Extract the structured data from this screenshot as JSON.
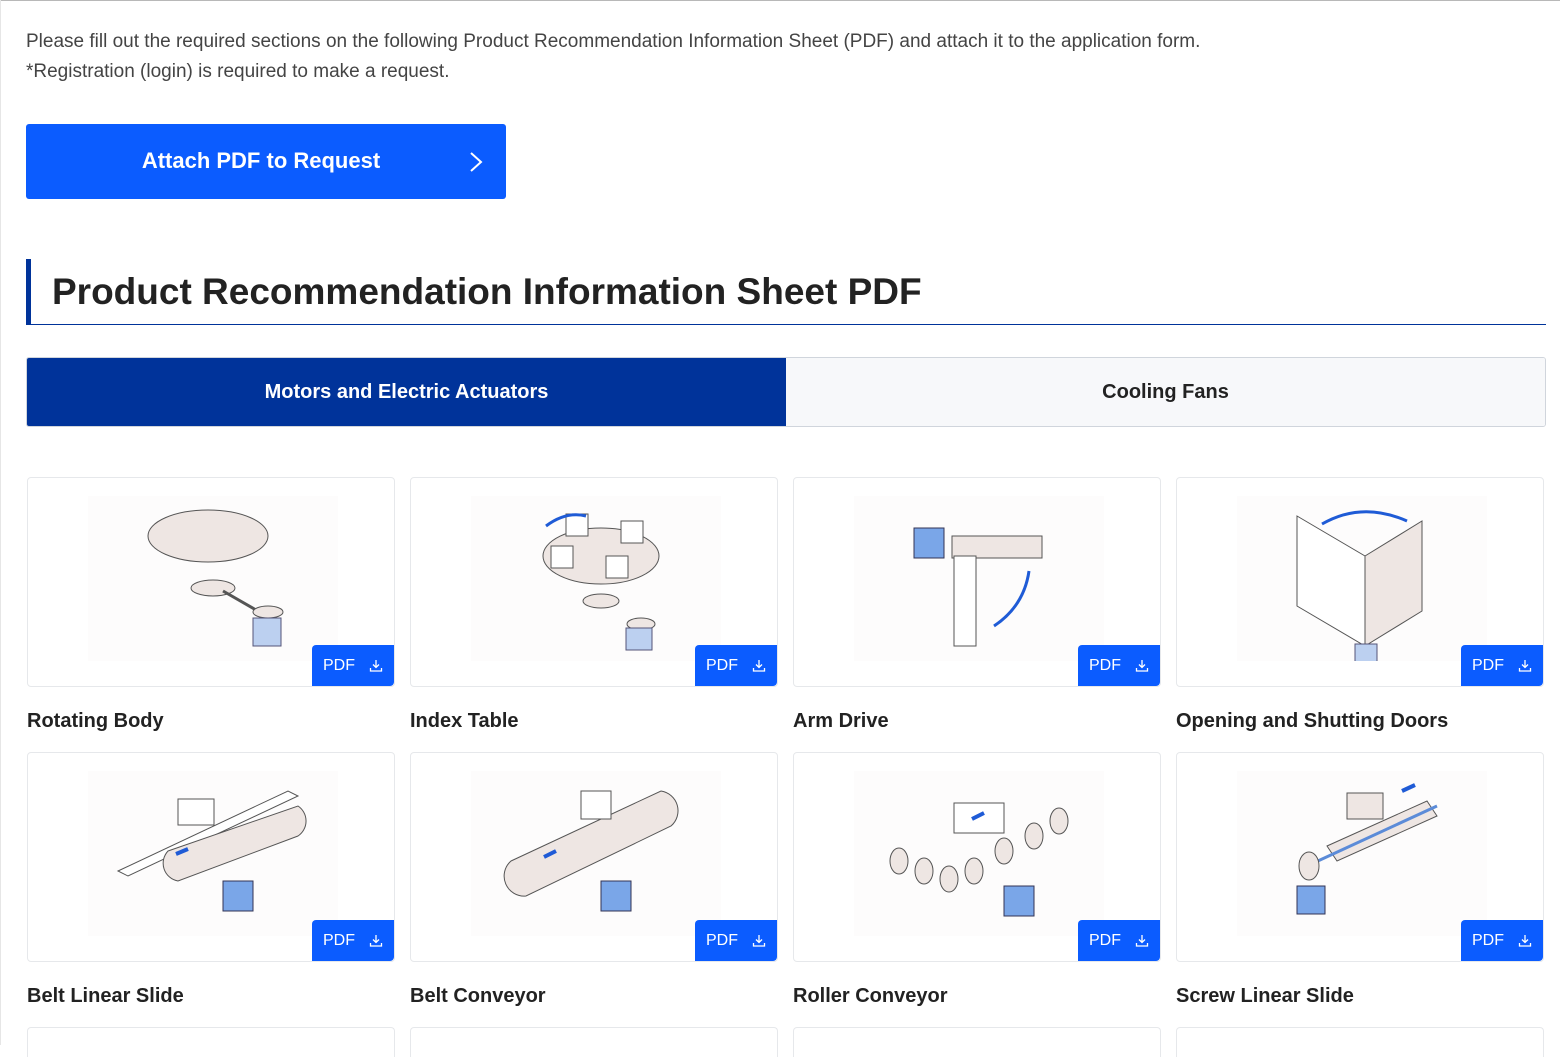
{
  "intro": {
    "line1": "Please fill out the required sections on the following Product Recommendation Information Sheet (PDF) and attach it to the application form.",
    "line2": "*Registration (login) is required to make a request."
  },
  "attach_button": {
    "label": "Attach PDF to Request",
    "icon": "chevron-right-icon"
  },
  "section": {
    "title": "Product Recommendation Information Sheet PDF"
  },
  "tabs": [
    {
      "label": "Motors and Electric Actuators",
      "active": true
    },
    {
      "label": "Cooling Fans",
      "active": false
    }
  ],
  "colors": {
    "primary_blue": "#0b5cff",
    "navy": "#00339a",
    "text": "#222222"
  },
  "pdf_button": {
    "label": "PDF",
    "icon": "download-icon"
  },
  "cards": [
    {
      "title": "Rotating Body",
      "illustration": "rotating-table-belt-drive"
    },
    {
      "title": "Index Table",
      "illustration": "index-table-with-boxes"
    },
    {
      "title": "Arm Drive",
      "illustration": "motor-driven-arm"
    },
    {
      "title": "Opening and Shutting Doors",
      "illustration": "hinged-door-motor"
    },
    {
      "title": "Belt Linear Slide",
      "illustration": "belt-linear-slide"
    },
    {
      "title": "Belt Conveyor",
      "illustration": "belt-conveyor"
    },
    {
      "title": "Roller Conveyor",
      "illustration": "roller-conveyor"
    },
    {
      "title": "Screw Linear Slide",
      "illustration": "screw-linear-slide"
    }
  ]
}
